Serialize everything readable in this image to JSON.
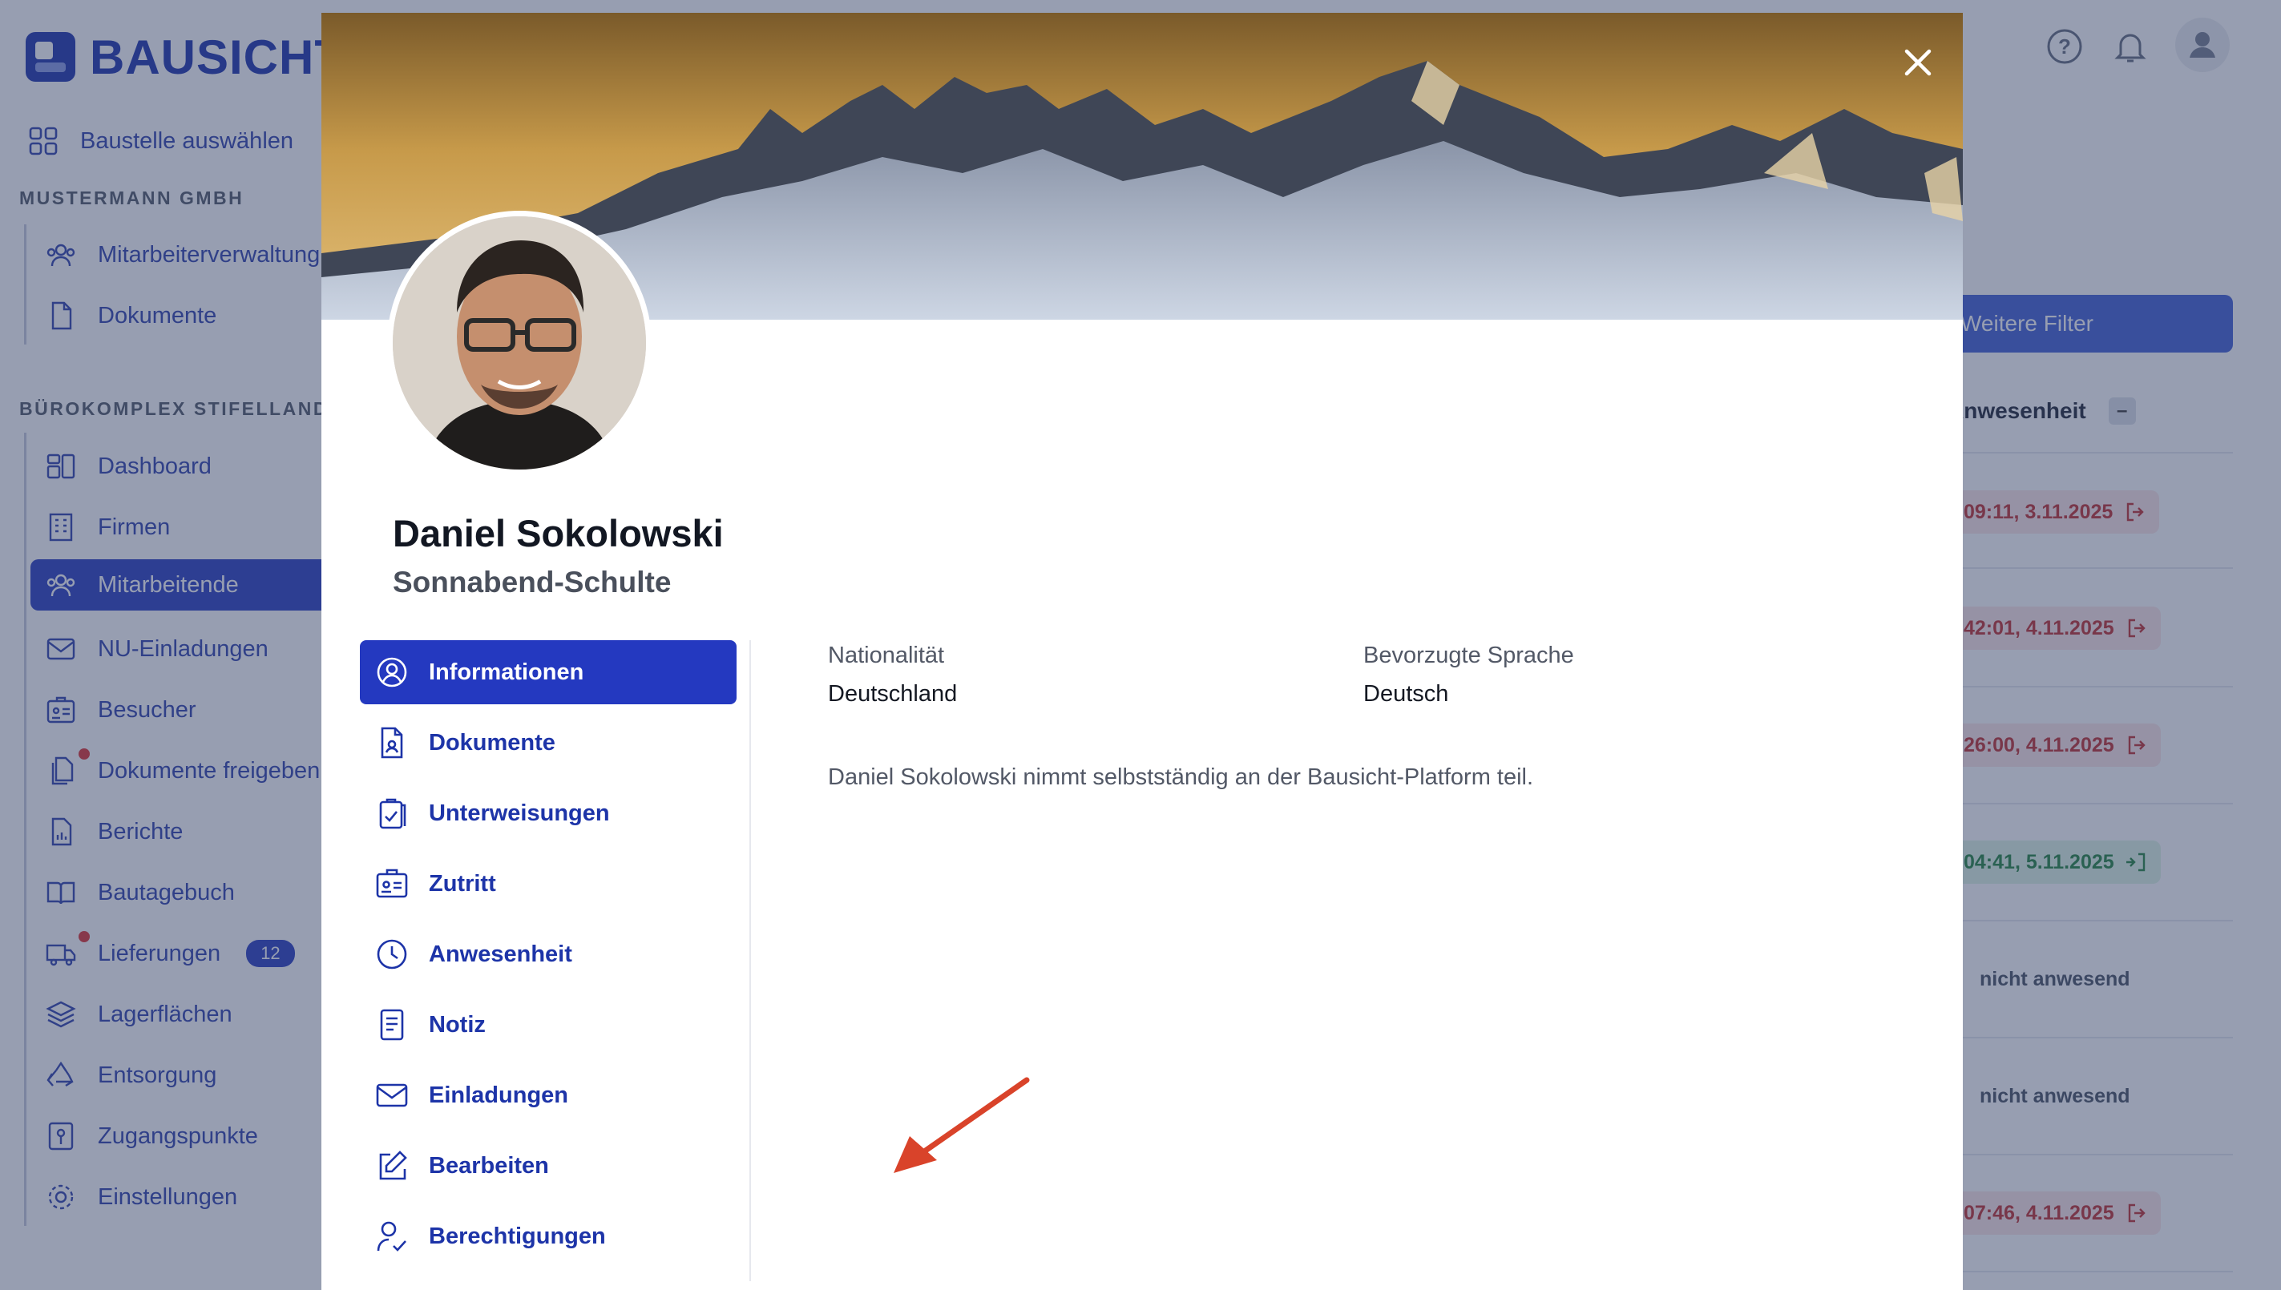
{
  "app": {
    "logo_text": "BAUSICHT",
    "top_icons": [
      "help-icon",
      "bell-icon",
      "user-avatar-icon"
    ],
    "sidebar": {
      "select_site": "Baustelle auswählen",
      "group1": {
        "label": "MUSTERMANN GMBH",
        "items": [
          "Mitarbeiterverwaltung",
          "Dokumente"
        ]
      },
      "group2": {
        "label": "BÜROKOMPLEX STIFELLAND",
        "items": [
          "Dashboard",
          "Firmen",
          "Mitarbeitende",
          "NU-Einladungen",
          "Besucher",
          "Dokumente freigeben",
          "Berichte",
          "Bautagebuch",
          "Lieferungen",
          "Lagerflächen",
          "Entsorgung",
          "Zugangspunkte",
          "Einstellungen"
        ],
        "active_item": "Mitarbeitende",
        "lieferungen_badge": "12"
      }
    },
    "filter_button": "Weitere Filter",
    "column_header": "Anwesenheit",
    "rows": [
      {
        "text": "09:11, 3.11.2025",
        "status": "red",
        "icon": "exit-icon"
      },
      {
        "text": "42:01, 4.11.2025",
        "status": "red",
        "icon": "exit-icon"
      },
      {
        "text": "26:00, 4.11.2025",
        "status": "red",
        "icon": "exit-icon"
      },
      {
        "text": "04:41, 5.11.2025",
        "status": "green",
        "icon": "enter-icon"
      },
      {
        "text": "nicht anwesend",
        "status": "gray"
      },
      {
        "text": "nicht anwesend",
        "status": "gray"
      },
      {
        "text": "07:46, 4.11.2025",
        "status": "red",
        "icon": "exit-icon"
      }
    ]
  },
  "modal": {
    "first_name_line": "Daniel Sokolowski",
    "second_line": "Sonnabend-Schulte",
    "menu": [
      {
        "label": "Informationen",
        "icon": "user-circle-icon",
        "active": true
      },
      {
        "label": "Dokumente",
        "icon": "document-user-icon",
        "active": false
      },
      {
        "label": "Unterweisungen",
        "icon": "clipboard-check-icon",
        "active": false
      },
      {
        "label": "Zutritt",
        "icon": "id-badge-icon",
        "active": false
      },
      {
        "label": "Anwesenheit",
        "icon": "clock-icon",
        "active": false
      },
      {
        "label": "Notiz",
        "icon": "note-icon",
        "active": false
      },
      {
        "label": "Einladungen",
        "icon": "envelope-icon",
        "active": false
      },
      {
        "label": "Bearbeiten",
        "icon": "edit-icon",
        "active": false
      },
      {
        "label": "Berechtigungen",
        "icon": "user-check-icon",
        "active": false
      }
    ],
    "info": {
      "nationality_label": "Nationalität",
      "nationality_value": "Deutschland",
      "language_label": "Bevorzugte Sprache",
      "language_value": "Deutsch",
      "note": "Daniel Sokolowski nimmt selbstständig an der Bausicht-Platform teil."
    }
  },
  "colors": {
    "primary": "#2439c0",
    "menu_text": "#1d34a8",
    "annotation_arrow": "#d9432a",
    "overlay": "#26345c"
  }
}
